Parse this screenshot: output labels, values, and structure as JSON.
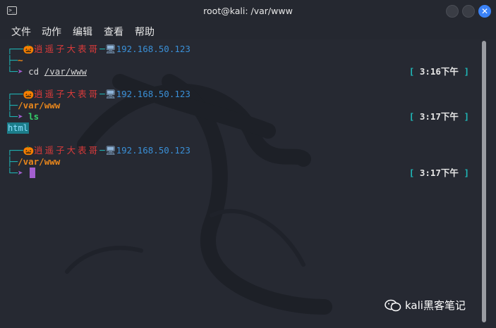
{
  "window": {
    "title": "root@kali: /var/www"
  },
  "menu": [
    "文件",
    "动作",
    "编辑",
    "查看",
    "帮助"
  ],
  "prompts": [
    {
      "user": "逍遥子大表哥",
      "ip": "192.168.50.123",
      "path": "~",
      "command_prefix": "cd ",
      "command_arg": "/var/www",
      "time": "3:16下午"
    },
    {
      "user": "逍遥子大表哥",
      "ip": "192.168.50.123",
      "path": "/var/www",
      "command": "ls",
      "time": "3:17下午"
    },
    {
      "user": "逍遥子大表哥",
      "ip": "192.168.50.123",
      "path": "/var/www",
      "command": "",
      "time": "3:17下午"
    }
  ],
  "output": {
    "ls_result": "html"
  },
  "watermark": {
    "text": "kali黑客笔记"
  },
  "colors": {
    "accent_close": "#3b82f6",
    "frame": "#1fb8b8",
    "path": "#e8861c",
    "user": "#d93b3b",
    "ip": "#3a8fd6",
    "arrow": "#a35fd0",
    "command": "#35d16b"
  },
  "icons": [
    "terminal-icon",
    "pumpkin-icon",
    "computer-icon",
    "wechat-icon"
  ]
}
